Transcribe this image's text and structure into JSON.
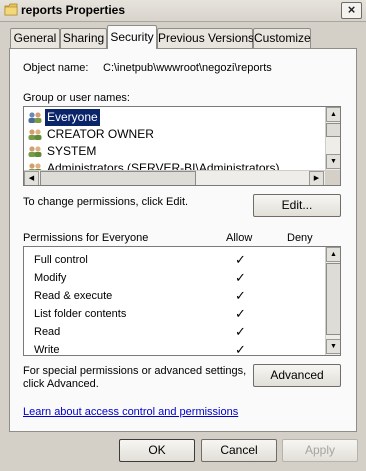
{
  "window": {
    "title": "reports Properties",
    "close_label": "×"
  },
  "tabs": [
    {
      "label": "General"
    },
    {
      "label": "Sharing"
    },
    {
      "label": "Security"
    },
    {
      "label": "Previous Versions"
    },
    {
      "label": "Customize"
    }
  ],
  "object": {
    "label": "Object name:",
    "value": "C:\\inetpub\\wwwroot\\negozi\\reports"
  },
  "group": {
    "label": "Group or user names:",
    "items": [
      {
        "label": "Everyone"
      },
      {
        "label": "CREATOR OWNER"
      },
      {
        "label": "SYSTEM"
      },
      {
        "label": "Administrators (SERVER-BI\\Administrators)"
      }
    ]
  },
  "change_hint": "To change permissions, click Edit.",
  "edit_label": "Edit...",
  "permissions": {
    "header": "Permissions for Everyone",
    "allow_label": "Allow",
    "deny_label": "Deny",
    "check_glyph": "✓",
    "rows": [
      {
        "label": "Full control"
      },
      {
        "label": "Modify"
      },
      {
        "label": "Read & execute"
      },
      {
        "label": "List folder contents"
      },
      {
        "label": "Read"
      },
      {
        "label": "Write"
      }
    ]
  },
  "advanced": {
    "hint_line1": "For special permissions or advanced settings,",
    "hint_line2": "click Advanced.",
    "button_label": "Advanced"
  },
  "learn_link": "Learn about access control and permissions",
  "footer": {
    "ok_label": "OK",
    "cancel_label": "Cancel",
    "apply_label": "Apply"
  },
  "colors": {
    "selection": "#0a246a",
    "link": "#0000cc",
    "face": "#d4d0c8"
  }
}
